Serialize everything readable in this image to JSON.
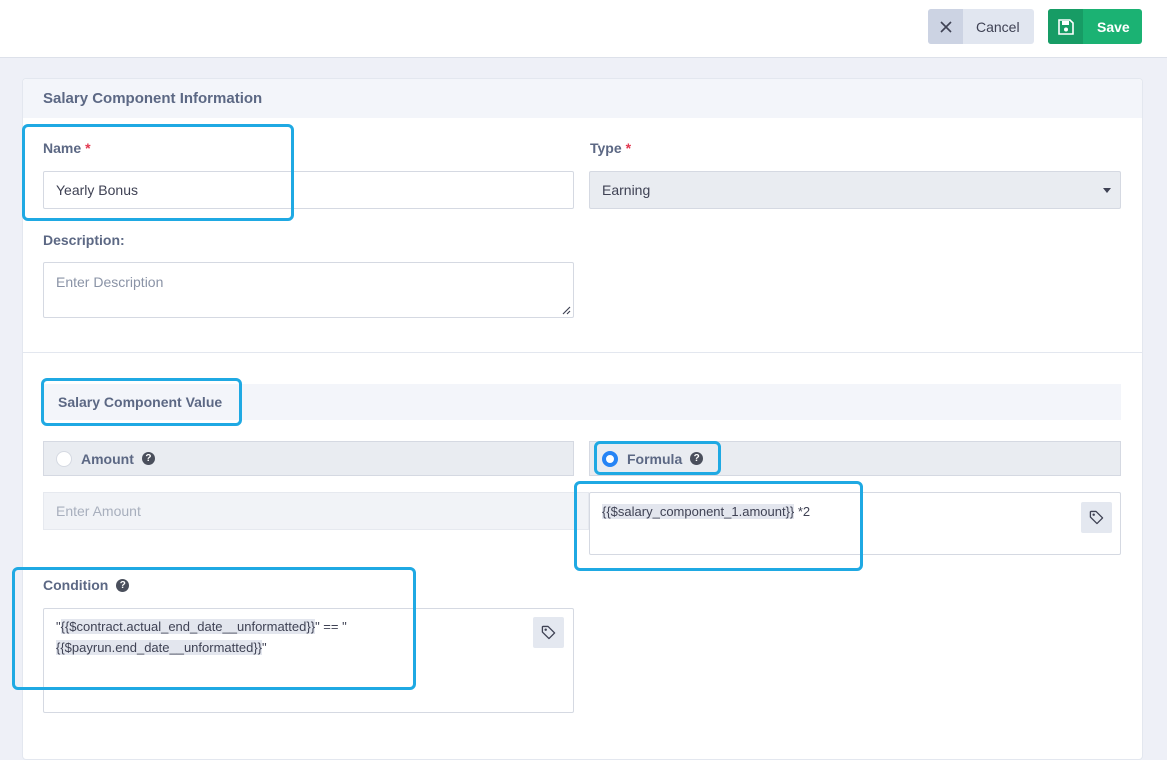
{
  "toolbar": {
    "cancel_label": "Cancel",
    "save_label": "Save",
    "accent": "#1bb273"
  },
  "form": {
    "section_title": "Salary Component Information",
    "name": {
      "label": "Name",
      "required_mark": "*",
      "value": "Yearly Bonus"
    },
    "type": {
      "label": "Type",
      "required_mark": "*",
      "selected": "Earning"
    },
    "description": {
      "label": "Description:",
      "placeholder": "Enter Description"
    },
    "value_section": {
      "title": "Salary Component Value",
      "amount_option": {
        "label": "Amount",
        "selected": false
      },
      "formula_option": {
        "label": "Formula",
        "selected": true
      },
      "amount_placeholder": "Enter Amount",
      "formula": {
        "token": "{{$salary_component_1.amount}}",
        "suffix": " *2"
      }
    },
    "condition": {
      "label": "Condition",
      "line1_prefix": "\"",
      "line1_token": "{{$contract.actual_end_date__unformatted}}",
      "line1_suffix": "\" == \"",
      "line2_token": "{{$payrun.end_date__unformatted}}",
      "line2_suffix": "\""
    }
  },
  "icons": {
    "cancel": "close-icon",
    "save": "save-icon",
    "tag": "tag-icon",
    "help": "question-circle-icon",
    "dropdown": "chevron-down-icon"
  },
  "colors": {
    "highlight": "#1fa9e3",
    "radio_selected": "#2684f5",
    "required": "#e2374f"
  }
}
